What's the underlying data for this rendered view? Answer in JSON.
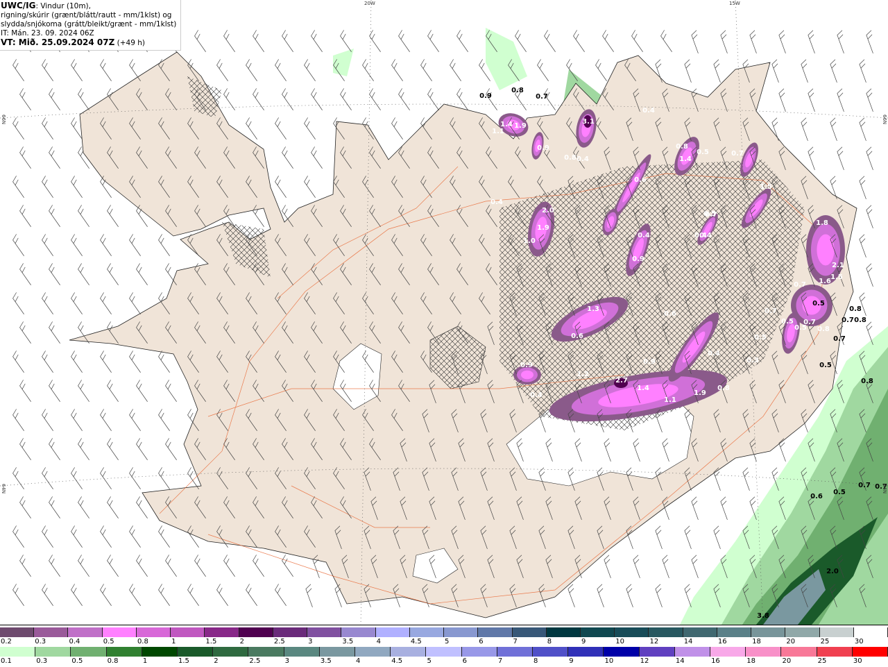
{
  "header": {
    "model": "UWC/IG",
    "line1": ": Vindur (10m),",
    "line2": "rigning/skúrir (grænt/blátt/rautt - mm/1klst) og",
    "line3": "slydda/snjókoma (grátt/bleikt/grænt - mm/1klst)",
    "it": "IT: Mán. 23. 09. 2024 06Z",
    "vt": "VT: Mið. 25.09.2024 07Z",
    "lead": " (+49 h)"
  },
  "grid_labels": {
    "lon1": "20W",
    "lon2": "15W",
    "lat_n_left": "66N",
    "lat_s_left": "64N",
    "lat_n_right": "66N",
    "lat_s_right": "64N"
  },
  "colors": {
    "land": "#f0e4d8",
    "sea": "#ffffff",
    "roads": "#e8602a",
    "glacier": "#ffffff"
  },
  "snow_legend": {
    "labels": [
      "0.2",
      "0.3",
      "0.4",
      "0.5",
      "0.8",
      "1",
      "1.5",
      "2",
      "2.5",
      "3",
      "3.5",
      "4",
      "4.5",
      "5",
      "6",
      "7",
      "8",
      "9",
      "10",
      "12",
      "14",
      "16",
      "18",
      "20",
      "25",
      "30"
    ],
    "colors": [
      "#6e4a6e",
      "#9a5a9a",
      "#c070c8",
      "#ff80ff",
      "#d868d8",
      "#c058c0",
      "#882888",
      "#500050",
      "#6a2a7a",
      "#8050a0",
      "#9888d0",
      "#b0b0ff",
      "#98a8e0",
      "#8898d0",
      "#6078a8",
      "#385878",
      "#003840",
      "#104850",
      "#184c58",
      "#285860",
      "#406870",
      "#5a8088",
      "#78959a",
      "#90a8a8",
      "#c8d0d0",
      "#ffffff"
    ]
  },
  "rain_legend": {
    "labels": [
      "0.1",
      "0.3",
      "0.5",
      "0.8",
      "1",
      "1.5",
      "2",
      "2.5",
      "3",
      "3.5",
      "4",
      "4.5",
      "5",
      "6",
      "7",
      "8",
      "9",
      "10",
      "12",
      "14",
      "16",
      "18",
      "20",
      "25",
      "30"
    ],
    "colors": [
      "#d0ffd0",
      "#a0d8a0",
      "#70b070",
      "#308030",
      "#004800",
      "#1a5a2a",
      "#2f6a40",
      "#4a7a60",
      "#5a8880",
      "#7a98a0",
      "#90a8c0",
      "#a8b0e0",
      "#c0c0ff",
      "#9898e8",
      "#7070d8",
      "#5050c8",
      "#3030b8",
      "#0000a8",
      "#6040c0",
      "#c090e8",
      "#f8a8e8",
      "#f890c8",
      "#f87898",
      "#f04050",
      "#ff0000"
    ]
  },
  "snow_values": [
    "1.1",
    "1.4",
    "1.9",
    "0.9",
    "3.1",
    "0.8",
    "0.4",
    "2.0",
    "1.9",
    "1.0",
    "0.4",
    "0.4",
    "0.6",
    "0.8",
    "1.4",
    "0.5",
    "0.7",
    "1.5",
    "0.4",
    "0.5",
    "0.4",
    "0.9",
    "0.7",
    "0.4",
    "1.3",
    "0.6",
    "0.9",
    "0.6",
    "0.9",
    "1.2",
    "2.7",
    "1.4",
    "1.1",
    "1.9",
    "0.8",
    "0.4",
    "0.3",
    "0.5",
    "0.7",
    "0.5",
    "1.8",
    "2.1",
    "1.5",
    "1.6",
    "0.7",
    "0.7",
    "0.5",
    "0.8",
    "0.4"
  ],
  "rain_values": [
    "0.9",
    "0.8",
    "0.7",
    "0.8",
    "0.8",
    "0.5",
    "0.7",
    "0.7",
    "0.5",
    "0.8",
    "0.7",
    "0.6",
    "0.5",
    "0.7",
    "2.0",
    "3.8"
  ]
}
